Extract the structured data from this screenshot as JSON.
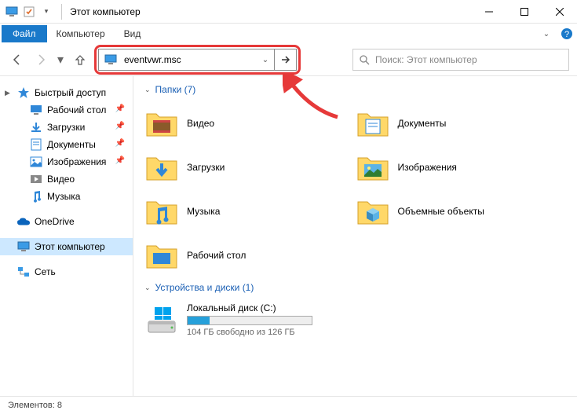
{
  "window": {
    "title": "Этот компьютер"
  },
  "menubar": {
    "file": "Файл",
    "computer": "Компьютер",
    "view": "Вид"
  },
  "address": {
    "value": "eventvwr.msc"
  },
  "search": {
    "placeholder": "Поиск: Этот компьютер"
  },
  "sidebar": {
    "quickaccess": "Быстрый доступ",
    "items": [
      {
        "label": "Рабочий стол"
      },
      {
        "label": "Загрузки"
      },
      {
        "label": "Документы"
      },
      {
        "label": "Изображения"
      },
      {
        "label": "Видео"
      },
      {
        "label": "Музыка"
      }
    ],
    "onedrive": "OneDrive",
    "thispc": "Этот компьютер",
    "network": "Сеть"
  },
  "content": {
    "folders_header": "Папки (7)",
    "folders_left": [
      {
        "label": "Видео"
      },
      {
        "label": "Загрузки"
      },
      {
        "label": "Музыка"
      },
      {
        "label": "Рабочий стол"
      }
    ],
    "folders_right": [
      {
        "label": "Документы"
      },
      {
        "label": "Изображения"
      },
      {
        "label": "Объемные объекты"
      }
    ],
    "devices_header": "Устройства и диски (1)",
    "drive": {
      "name": "Локальный диск (C:)",
      "meta": "104 ГБ свободно из 126 ГБ"
    }
  },
  "statusbar": {
    "text": "Элементов: 8"
  }
}
